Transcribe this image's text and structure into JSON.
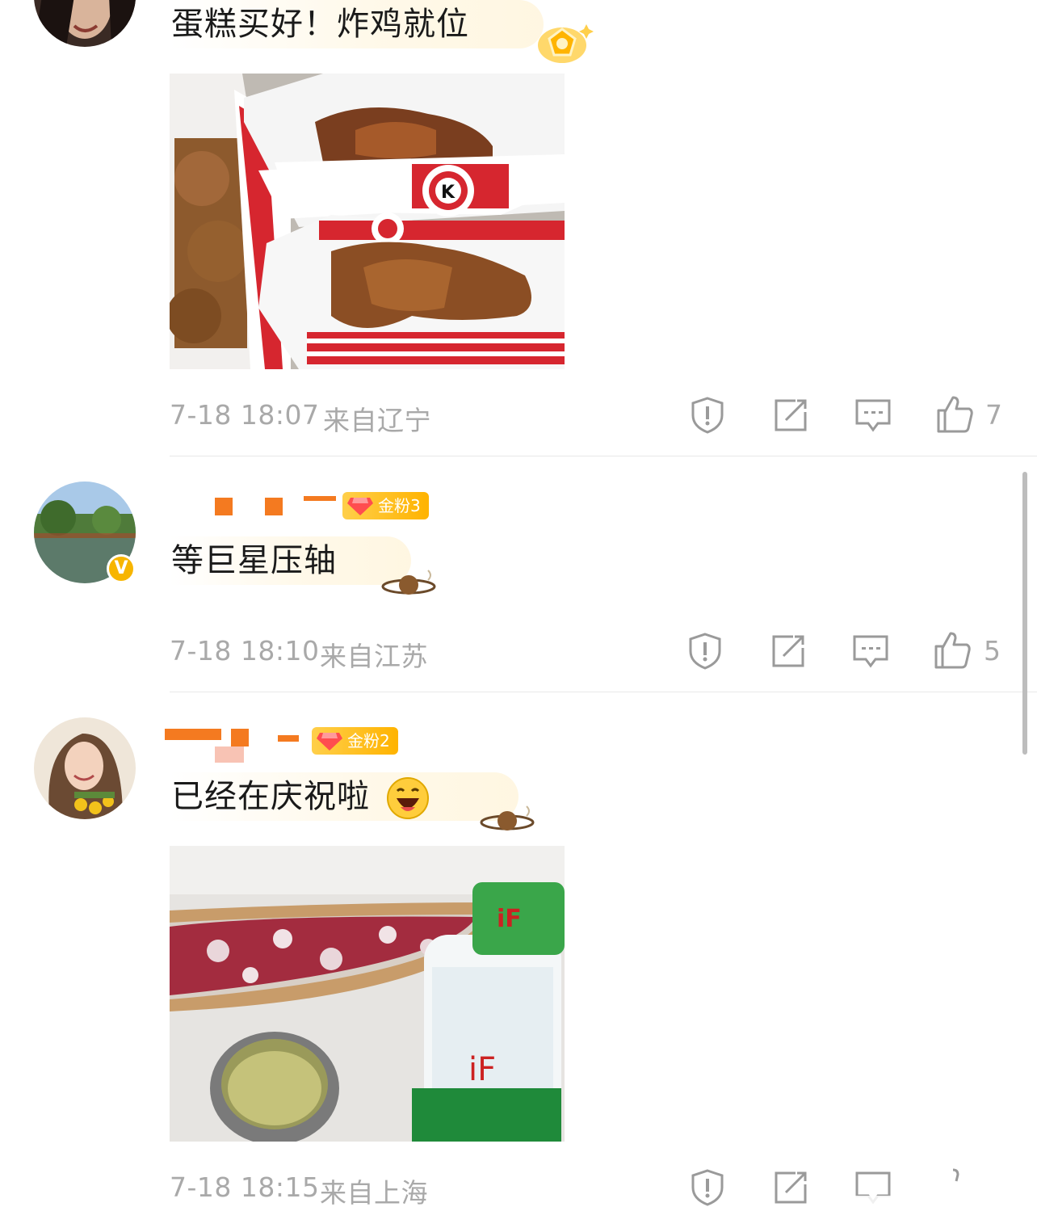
{
  "comments": [
    {
      "text": "蛋糕买好！炸鸡就位",
      "time": "7-18 18:07",
      "location": "来自辽宁",
      "likes": "7",
      "has_photo": true
    },
    {
      "fan_badge": "金粉3",
      "text": "等巨星压轴",
      "time": "7-18 18:10",
      "location": "来自江苏",
      "likes": "5",
      "verified": "V"
    },
    {
      "fan_badge": "金粉2",
      "text": "已经在庆祝啦",
      "time": "7-18 18:15",
      "location": "来自上海",
      "likes": "",
      "has_photo": true
    }
  ],
  "photo2": {
    "bottle_brand": "iF"
  },
  "icons": [
    "report-icon",
    "share-icon",
    "reply-icon",
    "thumbs-up-icon"
  ],
  "colors": {
    "meta_text": "#a9a9a9",
    "badge_gold": "#ffb300",
    "kfc_red": "#d6262f",
    "verified": "#f7b500"
  }
}
